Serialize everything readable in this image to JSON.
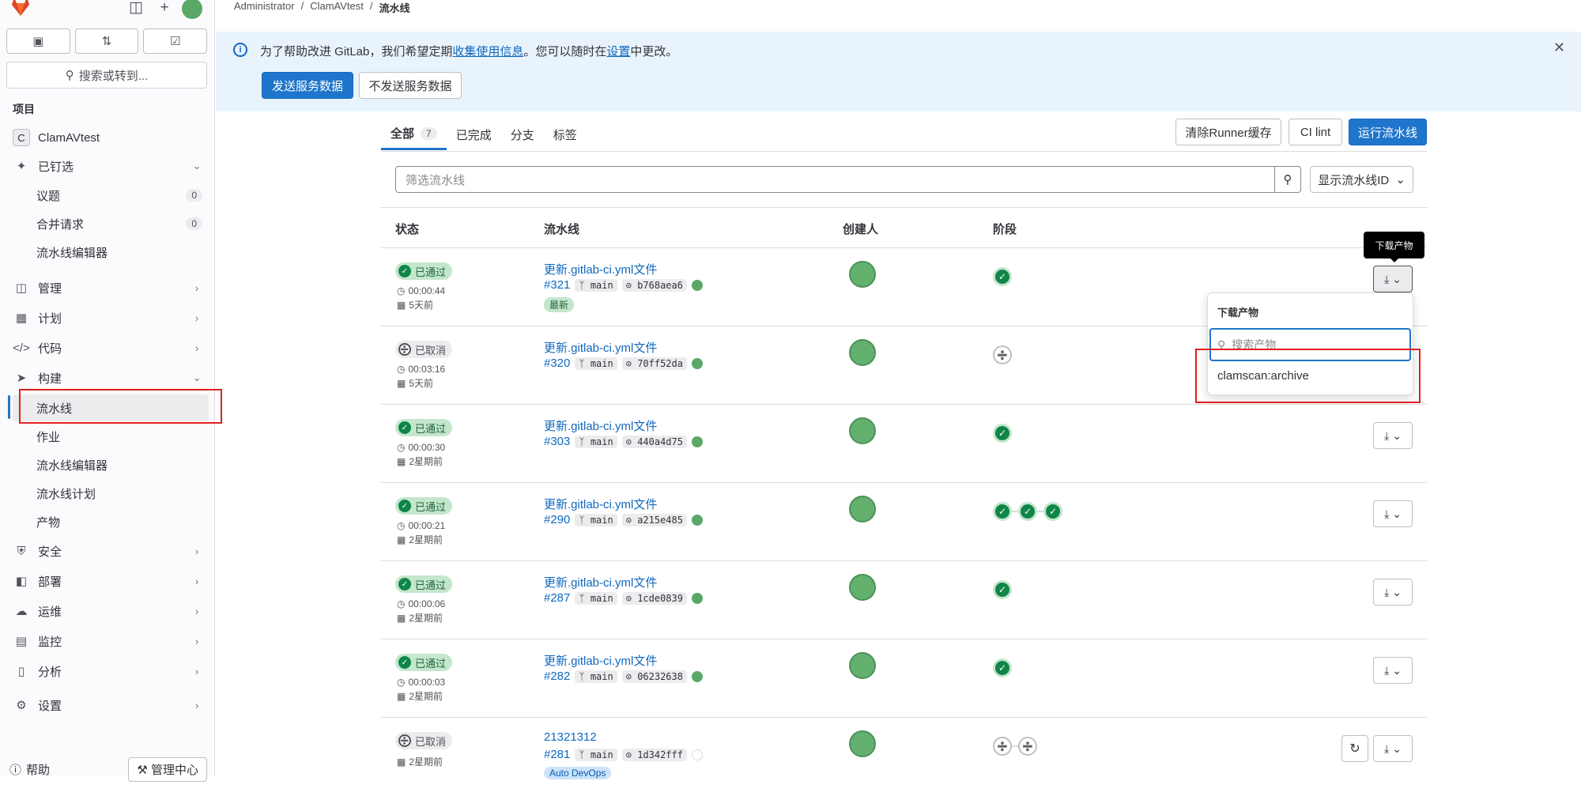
{
  "breadcrumb": [
    "Administrator",
    "ClamAVtest",
    "流水线"
  ],
  "sidebar": {
    "search_label": "搜索或转到...",
    "section_title": "项目",
    "project_initial": "C",
    "project_name": "ClamAVtest",
    "pinned": "已钉选",
    "pinned_items": [
      {
        "label": "议题",
        "count": "0"
      },
      {
        "label": "合并请求",
        "count": "0"
      },
      {
        "label": "流水线编辑器"
      }
    ],
    "groups": {
      "manage": "管理",
      "plan": "计划",
      "code": "代码",
      "build": "构建",
      "secure": "安全",
      "deploy": "部署",
      "operate": "运维",
      "monitor": "监控",
      "analyze": "分析",
      "settings": "设置"
    },
    "build_items": [
      "流水线",
      "作业",
      "流水线编辑器",
      "流水线计划",
      "产物"
    ],
    "help": "帮助",
    "admin": "管理中心"
  },
  "banner": {
    "text_prefix": "为了帮助改进 GitLab，我们希望定期",
    "link1": "收集使用信息",
    "text_mid": "。您可以随时在",
    "link2": "设置",
    "text_suffix": "中更改。",
    "send_button": "发送服务数据",
    "dont_send_button": "不发送服务数据"
  },
  "tabs": {
    "all": "全部",
    "all_count": "7",
    "finished": "已完成",
    "branches": "分支",
    "tags": "标签"
  },
  "actions": {
    "clear_cache": "清除Runner缓存",
    "ci_lint": "CI lint",
    "run_pipeline": "运行流水线"
  },
  "filter": {
    "placeholder": "筛选流水线",
    "display_select": "显示流水线ID"
  },
  "table": {
    "headers": [
      "状态",
      "流水线",
      "创建人",
      "阶段"
    ]
  },
  "pipelines": [
    {
      "status": "已通过",
      "duration": "00:00:44",
      "finished": "5天前",
      "title": "更新.gitlab-ci.yml文件",
      "id": "#321",
      "ref": "main",
      "sha": "b768aea6",
      "tag": "最新",
      "stages": 1
    },
    {
      "status": "已取消",
      "duration": "00:03:16",
      "finished": "5天前",
      "title": "更新.gitlab-ci.yml文件",
      "id": "#320",
      "ref": "main",
      "sha": "70ff52da",
      "stages": 1
    },
    {
      "status": "已通过",
      "duration": "00:00:30",
      "finished": "2星期前",
      "title": "更新.gitlab-ci.yml文件",
      "id": "#303",
      "ref": "main",
      "sha": "440a4d75",
      "stages": 1
    },
    {
      "status": "已通过",
      "duration": "00:00:21",
      "finished": "2星期前",
      "title": "更新.gitlab-ci.yml文件",
      "id": "#290",
      "ref": "main",
      "sha": "a215e485",
      "stages": 3
    },
    {
      "status": "已通过",
      "duration": "00:00:06",
      "finished": "2星期前",
      "title": "更新.gitlab-ci.yml文件",
      "id": "#287",
      "ref": "main",
      "sha": "1cde0839",
      "stages": 1
    },
    {
      "status": "已通过",
      "duration": "00:00:03",
      "finished": "2星期前",
      "title": "更新.gitlab-ci.yml文件",
      "id": "#282",
      "ref": "main",
      "sha": "06232638",
      "stages": 1
    },
    {
      "status": "已取消",
      "finished": "2星期前",
      "title": "21321312",
      "id": "#281",
      "ref": "main",
      "sha": "1d342fff",
      "tag": "Auto DevOps",
      "stages": 2
    }
  ],
  "artifacts_dropdown": {
    "tooltip": "下载产物",
    "title": "下载产物",
    "search_placeholder": "搜索产物",
    "items": [
      "clamscan:archive"
    ]
  },
  "colors": {
    "accent": "#1f75cb",
    "passed": "#108548",
    "banner_bg": "#e9f3fc",
    "highlight": "#e02020"
  }
}
